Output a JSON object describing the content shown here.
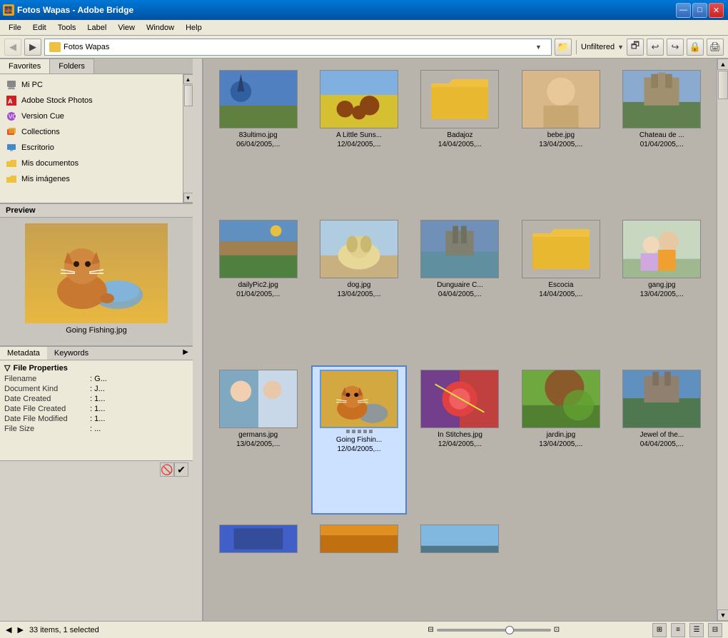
{
  "window": {
    "title": "Fotos Wapas - Adobe Bridge",
    "icon": "🌉"
  },
  "titlebar": {
    "minimize_label": "—",
    "maximize_label": "□",
    "close_label": "✕"
  },
  "menu": {
    "items": [
      "File",
      "Edit",
      "Tools",
      "Label",
      "View",
      "Window",
      "Help"
    ]
  },
  "toolbar": {
    "back_label": "◀",
    "forward_label": "▶",
    "address": "Fotos Wapas",
    "filter_label": "Unfiltered",
    "filter_dropdown": "▼"
  },
  "sidebar": {
    "tabs": [
      "Favorites",
      "Folders"
    ],
    "favorites": [
      {
        "label": "Mi PC",
        "icon": "computer"
      },
      {
        "label": "Adobe Stock Photos",
        "icon": "adobe"
      },
      {
        "label": "Version Cue",
        "icon": "versioncue"
      },
      {
        "label": "Collections",
        "icon": "collections"
      },
      {
        "label": "Escritorio",
        "icon": "desktop"
      },
      {
        "label": "Mis documentos",
        "icon": "folder"
      },
      {
        "label": "Mis imágenes",
        "icon": "folder"
      }
    ]
  },
  "preview": {
    "header": "Preview",
    "filename": "Going Fishing.jpg"
  },
  "metadata": {
    "tabs": [
      "Metadata",
      "Keywords"
    ],
    "section": "File Properties",
    "rows": [
      {
        "label": "Filename",
        "value": ": G..."
      },
      {
        "label": "Document Kind",
        "value": ": J..."
      },
      {
        "label": "Date Created",
        "value": ": 1..."
      },
      {
        "label": "Date File Created",
        "value": ": 1..."
      },
      {
        "label": "Date File Modified",
        "value": ": 1..."
      },
      {
        "label": "File Size",
        "value": ": ..."
      }
    ]
  },
  "thumbnails": [
    {
      "name": "83ultimo.jpg",
      "date": "06/04/2005,...",
      "type": "landscape",
      "selected": false
    },
    {
      "name": "A Little Suns...",
      "date": "12/04/2005,...",
      "type": "sunflowers",
      "selected": false
    },
    {
      "name": "Badajoz",
      "date": "14/04/2005,...",
      "type": "folder",
      "selected": false
    },
    {
      "name": "bebe.jpg",
      "date": "13/04/2005,...",
      "type": "baby",
      "selected": false
    },
    {
      "name": "Chateau de ...",
      "date": "01/04/2005,...",
      "type": "castle",
      "selected": false
    },
    {
      "name": "dailyPic2.jpg",
      "date": "01/04/2005,...",
      "type": "landscape2",
      "selected": false
    },
    {
      "name": "dog.jpg",
      "date": "13/04/2005,...",
      "type": "dog",
      "selected": false
    },
    {
      "name": "Dunguaire C...",
      "date": "04/04/2005,...",
      "type": "castle2",
      "selected": false
    },
    {
      "name": "Escocia",
      "date": "14/04/2005,...",
      "type": "folder2",
      "selected": false
    },
    {
      "name": "gang.jpg",
      "date": "13/04/2005,...",
      "type": "kids",
      "selected": false
    },
    {
      "name": "germans.jpg",
      "date": "13/04/2005,...",
      "type": "baby2",
      "selected": false
    },
    {
      "name": "Going Fishin...",
      "date": "12/04/2005,...",
      "type": "cat-selected",
      "selected": true
    },
    {
      "name": "In Stitches.jpg",
      "date": "12/04/2005,...",
      "type": "colorful",
      "selected": false
    },
    {
      "name": "jardin.jpg",
      "date": "13/04/2005,...",
      "type": "garden",
      "selected": false
    },
    {
      "name": "Jewel of the...",
      "date": "04/04/2005,...",
      "type": "jewel",
      "selected": false
    },
    {
      "name": "",
      "date": "",
      "type": "blue",
      "selected": false
    },
    {
      "name": "",
      "date": "",
      "type": "orange",
      "selected": false
    },
    {
      "name": "",
      "date": "",
      "type": "water",
      "selected": false
    }
  ],
  "statusbar": {
    "text": "33 items, 1 selected",
    "nav_back": "◀",
    "nav_forward": "▶"
  }
}
